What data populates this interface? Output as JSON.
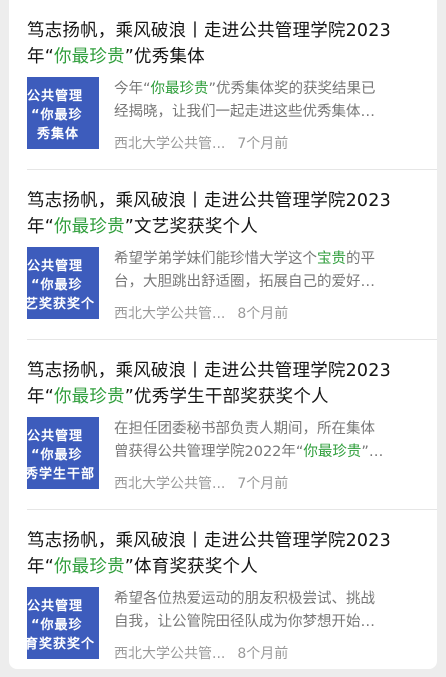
{
  "articles": [
    {
      "title_pre": "笃志扬帆，乘风破浪丨走进公共管理学院2023年“",
      "title_hl": "你最珍贵",
      "title_post": "”优秀集体",
      "thumb_lines": [
        "公共管理",
        "“你最珍",
        "秀集体"
      ],
      "excerpt_line1_pre": "今年“",
      "excerpt_line1_hl": "你最珍贵",
      "excerpt_line1_post": "”优秀集体奖的获奖结果已",
      "excerpt_line2_pre": "经揭晓，让我们一起走进这些优秀集体…",
      "excerpt_line2_hl": "",
      "excerpt_line2_post": "",
      "source": "西北大学公共管...",
      "time": "7个月前"
    },
    {
      "title_pre": "笃志扬帆，乘风破浪丨走进公共管理学院2023年“",
      "title_hl": "你最珍贵",
      "title_post": "”文艺奖获奖个人",
      "thumb_lines": [
        "公共管理",
        "“你最珍",
        "艺奖获奖个"
      ],
      "excerpt_line1_pre": "希望学弟学妹们能珍惜大学这个",
      "excerpt_line1_hl": "宝贵",
      "excerpt_line1_post": "的平",
      "excerpt_line2_pre": "台，大胆跳出舒适圈，拓展自己的爱好…",
      "excerpt_line2_hl": "",
      "excerpt_line2_post": "",
      "source": "西北大学公共管...",
      "time": "8个月前"
    },
    {
      "title_pre": "笃志扬帆，乘风破浪丨走进公共管理学院2023年“",
      "title_hl": "你最珍贵",
      "title_post": "”优秀学生干部奖获奖个人",
      "thumb_lines": [
        "公共管理",
        "“你最珍",
        "秀学生干部"
      ],
      "excerpt_line1_pre": "在担任团委秘书部负责人期间，所在集体",
      "excerpt_line1_hl": "",
      "excerpt_line1_post": "",
      "excerpt_line2_pre": "曾获得公共管理学院2022年“",
      "excerpt_line2_hl": "你最珍贵",
      "excerpt_line2_post": "”…",
      "source": "西北大学公共管...",
      "time": "7个月前"
    },
    {
      "title_pre": "笃志扬帆，乘风破浪丨走进公共管理学院2023年“",
      "title_hl": "你最珍贵",
      "title_post": "”体育奖获奖个人",
      "thumb_lines": [
        "公共管理",
        "“你最珍",
        "育奖获奖个"
      ],
      "excerpt_line1_pre": "希望各位热爱运动的朋友积极尝试、挑战",
      "excerpt_line1_hl": "",
      "excerpt_line1_post": "",
      "excerpt_line2_pre": "自我，让公管院田径队成为你梦想开始…",
      "excerpt_line2_hl": "",
      "excerpt_line2_post": "",
      "source": "西北大学公共管...",
      "time": "8个月前"
    }
  ],
  "colors": {
    "highlight": "#2f9e3b",
    "thumb_bg": "#3d5cbc",
    "page_bg": "#ededed"
  }
}
